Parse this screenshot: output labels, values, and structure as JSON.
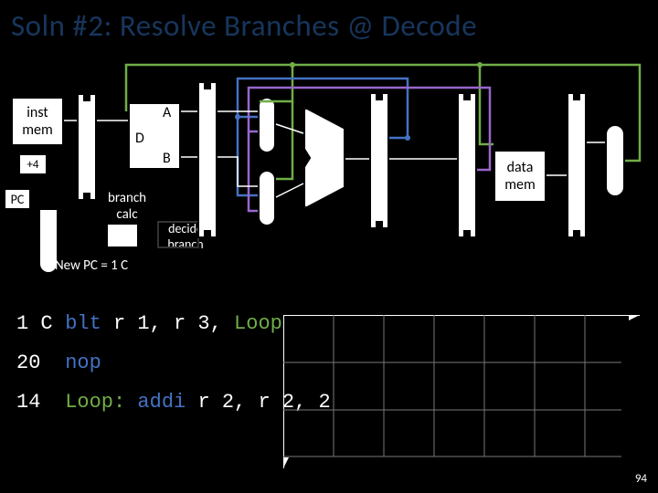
{
  "title": "Soln #2: Resolve Branches @ Decode",
  "blocks": {
    "inst_mem": "inst\nmem",
    "data_mem": "data\nmem",
    "plus4": "+4",
    "pc": "PC",
    "d": "D",
    "a": "A",
    "b": "B",
    "branch_calc": "branch\ncalc",
    "decide_branch": "decide\nbranch",
    "new_pc": "New PC = 1 C"
  },
  "instructions": [
    {
      "addr": "1 C",
      "text": "blt r 1, r 3, ",
      "label": "Loop",
      "is_branch": true
    },
    {
      "addr": "20",
      "text": "nop",
      "label": "",
      "is_branch": true
    },
    {
      "addr": "14",
      "text": "Loop: addi r 2, r 2, 2",
      "label": "",
      "is_branch": false,
      "has_prefix_label": true
    }
  ],
  "page": "94"
}
